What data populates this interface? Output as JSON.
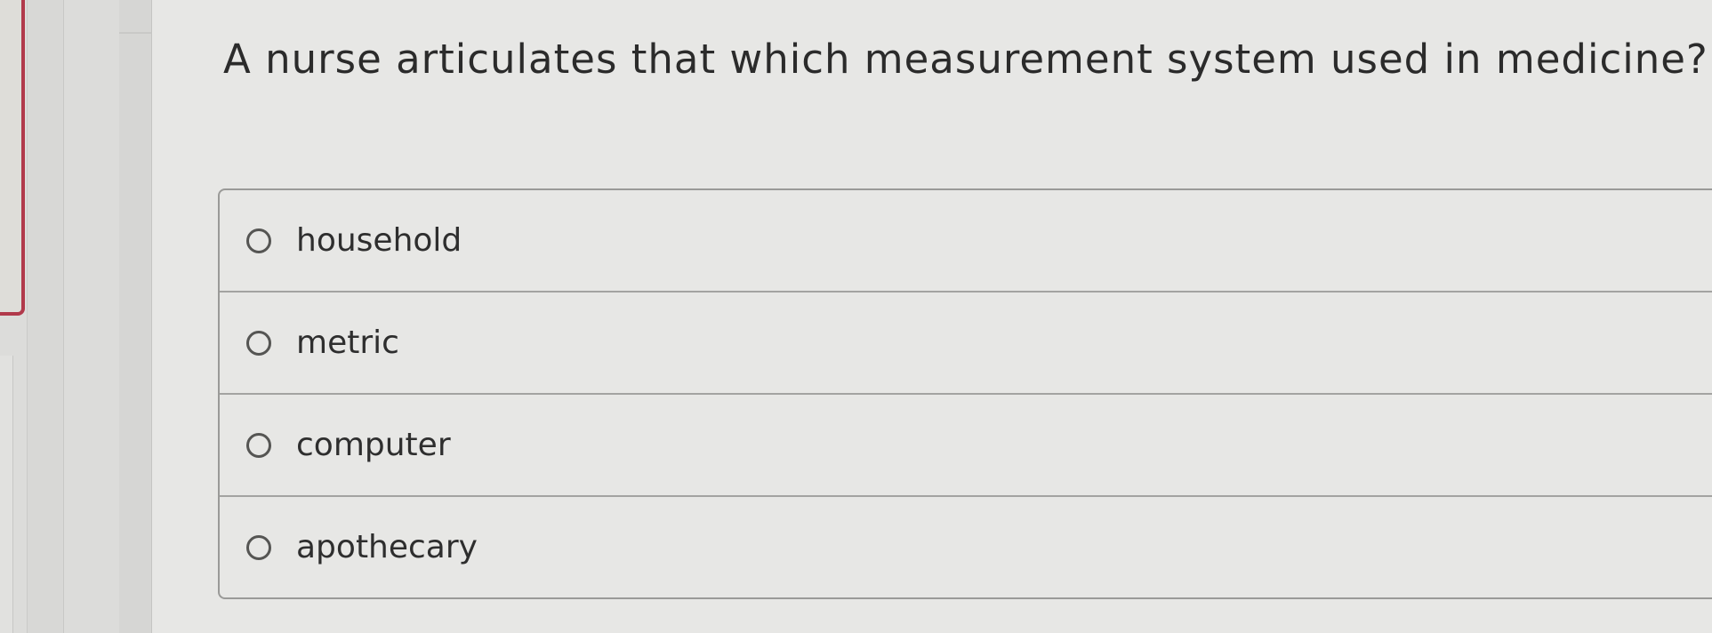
{
  "question": {
    "text": "A nurse articulates that which measurement system used in medicine?"
  },
  "options": [
    {
      "label": "household",
      "selected": false
    },
    {
      "label": "metric",
      "selected": false
    },
    {
      "label": "computer",
      "selected": false
    },
    {
      "label": "apothecary",
      "selected": false
    }
  ],
  "colors": {
    "background": "#e7e7e5",
    "accent_tab": "#b1394b",
    "text": "#2b2b2b",
    "border": "#9a9a98"
  }
}
